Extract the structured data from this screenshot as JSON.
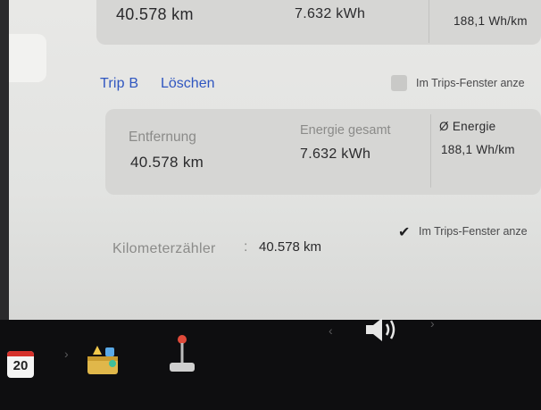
{
  "trip_a": {
    "distance": "40.578 km",
    "energy": "7.632 kWh",
    "avg_energy": "188,1 Wh/km"
  },
  "trip_b": {
    "title": "Trip B",
    "clear_label": "Löschen",
    "show_in_trips_label": "Im Trips-Fenster anze",
    "distance_label": "Entfernung",
    "distance_value": "40.578 km",
    "energy_label": "Energie gesamt",
    "energy_value": "7.632 kWh",
    "avg_label": "Ø Energie",
    "avg_value": "188,1 Wh/km"
  },
  "odometer": {
    "label": "Kilometerzähler",
    "separator": ":",
    "value": "40.578 km",
    "show_in_trips_label": "Im Trips-Fenster anze",
    "checked": true
  },
  "taskbar": {
    "calendar_day": "20",
    "icons": [
      "calendar-icon",
      "toybox-icon",
      "joystick-icon",
      "volume-icon"
    ],
    "volume_prev": "‹",
    "volume_next": "›"
  },
  "colors": {
    "link": "#2f56c0",
    "panel": "#e4e4e2",
    "card": "#d6d6d4",
    "taskbar": "#0e0e10"
  }
}
